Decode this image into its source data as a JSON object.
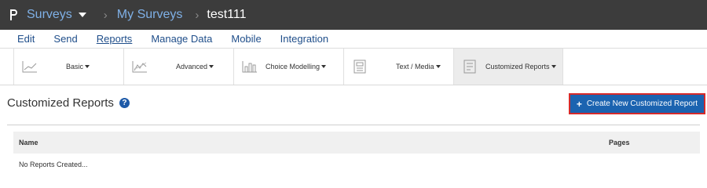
{
  "topbar": {
    "app_name": "Surveys",
    "section": "My Surveys",
    "current": "test111"
  },
  "nav": {
    "items": [
      "Edit",
      "Send",
      "Reports",
      "Manage Data",
      "Mobile",
      "Integration"
    ],
    "active": "Reports"
  },
  "toolbar": {
    "items": [
      {
        "label": "Basic",
        "icon": "line-chart-icon"
      },
      {
        "label": "Advanced",
        "icon": "trend-chart-icon"
      },
      {
        "label": "Choice Modelling",
        "icon": "bar-chart-icon"
      },
      {
        "label": "Text / Media",
        "icon": "text-media-icon"
      },
      {
        "label": "Customized Reports",
        "icon": "customized-report-icon"
      }
    ],
    "active": "Customized Reports"
  },
  "page": {
    "title": "Customized Reports",
    "help_symbol": "?",
    "create_button": "Create New Customized Report",
    "create_button_symbol": "+"
  },
  "table": {
    "columns": [
      "Name",
      "Pages"
    ],
    "empty_message": "No Reports Created..."
  },
  "colors": {
    "topbar_bg": "#3c3c3c",
    "link": "#1f4e8a",
    "primary_button": "#1b63b0",
    "highlight_border": "#d62a2a"
  }
}
